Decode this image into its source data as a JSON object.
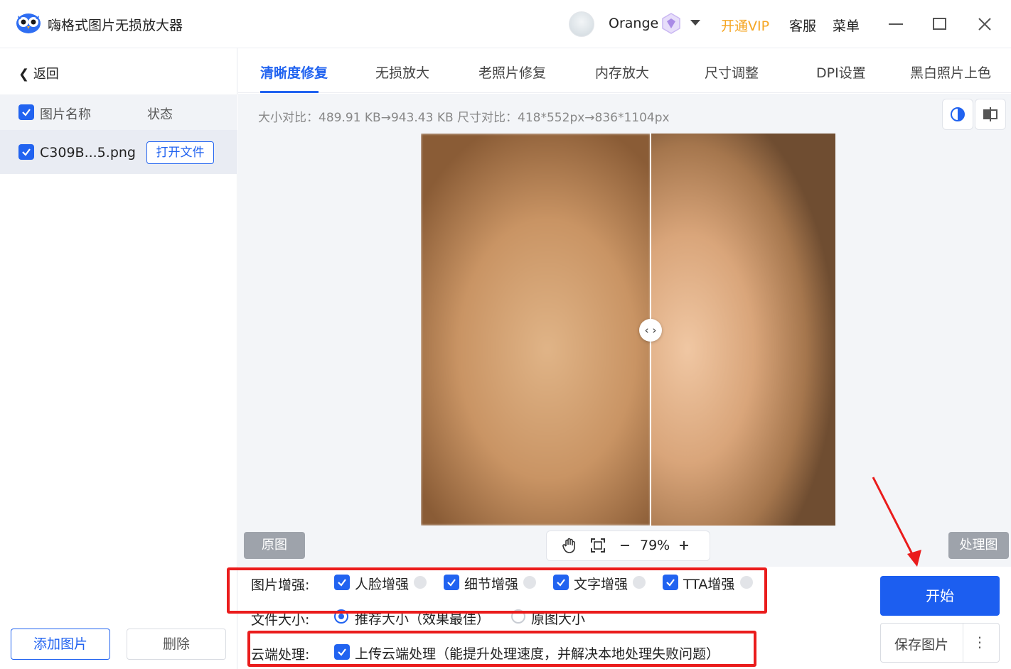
{
  "app": {
    "title": "嗨格式图片无损放大器",
    "username": "Orange",
    "vip_link": "开通VIP",
    "service": "客服",
    "menu": "菜单"
  },
  "sidebar": {
    "back": "返回",
    "col_name": "图片名称",
    "col_status": "状态",
    "files": [
      {
        "name": "C309B...5.png",
        "action": "打开文件",
        "checked": true
      }
    ],
    "add_button": "添加图片",
    "delete_button": "删除"
  },
  "tabs": [
    {
      "label": "清晰度修复",
      "active": true
    },
    {
      "label": "无损放大"
    },
    {
      "label": "老照片修复"
    },
    {
      "label": "内存放大"
    },
    {
      "label": "尺寸调整"
    },
    {
      "label": "DPI设置"
    },
    {
      "label": "黑白照片上色"
    }
  ],
  "preview": {
    "compare_info": "大小对比：489.91 KB→943.43 KB   尺寸对比：418*552px→836*1104px",
    "original_label": "原图",
    "processed_label": "处理图",
    "zoom": "79%"
  },
  "options": {
    "enhance_label": "图片增强:",
    "enhance_items": [
      "人脸增强",
      "细节增强",
      "文字增强",
      "TTA增强"
    ],
    "size_label": "文件大小:",
    "size_options": [
      "推荐大小（效果最佳）",
      "原图大小"
    ],
    "size_selected": "推荐大小（效果最佳）",
    "cloud_label": "云端处理:",
    "cloud_item": "上传云端处理（能提升处理速度，并解决本地处理失败问题）"
  },
  "actions": {
    "start": "开始",
    "save": "保存图片",
    "more": "⋮"
  },
  "colors": {
    "accent": "#2163f0",
    "vip": "#f5a623",
    "annotation": "#ea1c1c"
  }
}
